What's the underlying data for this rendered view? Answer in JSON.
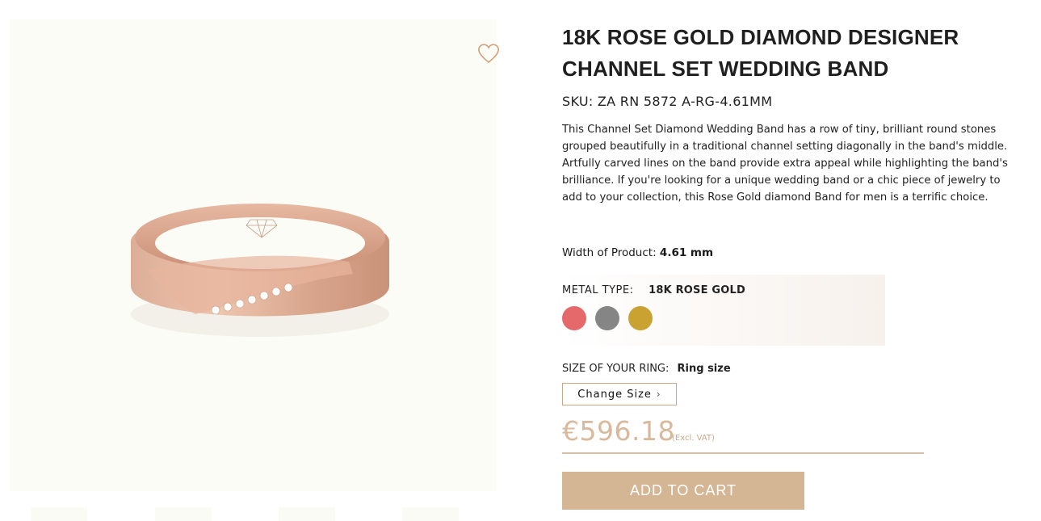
{
  "product": {
    "title": "18K ROSE GOLD DIAMOND DESIGNER CHANNEL SET WEDDING BAND",
    "sku": "SKU: ZA RN 5872 A-RG-4.61MM",
    "description": "This Channel Set Diamond Wedding Band has a row of tiny, brilliant round stones grouped beautifully in a traditional channel setting diagonally in the band's middle. Artfully carved lines on the band provide extra appeal while highlighting the band's brilliance. If you're looking for a unique wedding band or a chic piece of jewelry to add to your collection, this Rose Gold diamond Band for men is a terrific choice.",
    "width_label": "Width of Product:",
    "width_value": "4.61 mm"
  },
  "gallery": {
    "wishlist_icon": "heart-outline-icon",
    "thumbnail_count": 4
  },
  "metal": {
    "label": "METAL TYPE:",
    "selected": "18K ROSE GOLD",
    "swatches": [
      {
        "name": "rose-gold",
        "color": "#e5696b"
      },
      {
        "name": "white-gold",
        "color": "#858585"
      },
      {
        "name": "yellow-gold",
        "color": "#c9a232"
      }
    ]
  },
  "size": {
    "label": "SIZE OF YOUR RING:",
    "value": "Ring size",
    "button_label": "Change Size",
    "button_icon": "chevron-right-icon"
  },
  "pricing": {
    "price": "€596.18",
    "vat_note": "(Excl. VAT)"
  },
  "cart": {
    "button_label": "ADD TO CART"
  },
  "colors": {
    "accent": "#d4b594",
    "price": "#d9b99b",
    "gallery_bg": "#fcfcf7"
  }
}
